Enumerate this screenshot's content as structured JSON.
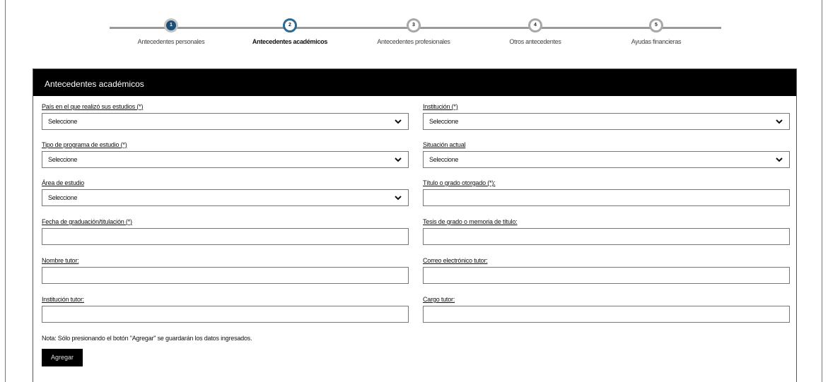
{
  "stepper": {
    "steps": [
      {
        "number": "1",
        "label": "Antecedentes personales",
        "state": "done"
      },
      {
        "number": "2",
        "label": "Antecedentes académicos",
        "state": "current"
      },
      {
        "number": "3",
        "label": "Antecedentes profesionales",
        "state": "pending"
      },
      {
        "number": "4",
        "label": "Otros antecedentes",
        "state": "pending"
      },
      {
        "number": "5",
        "label": "Ayudas financieras",
        "state": "pending"
      }
    ]
  },
  "panel": {
    "title": "Antecedentes académicos",
    "fields": {
      "pais": {
        "label": "País en el que realizó sus estudios (*)",
        "value": "Seleccione"
      },
      "institucion": {
        "label": "Institución (*)",
        "value": "Seleccione"
      },
      "tipo_programa": {
        "label": "Tipo de programa de estudio (*)",
        "value": "Seleccione"
      },
      "situacion": {
        "label": "Situación actual",
        "value": "Seleccione"
      },
      "area": {
        "label": "Área de estudio",
        "value": "Seleccione"
      },
      "titulo": {
        "label": "Título o grado otorgado (*):",
        "value": ""
      },
      "fecha": {
        "label": "Fecha de graduación/titulación (*)",
        "value": ""
      },
      "tesis": {
        "label": "Tesis de grado o memoria de título:",
        "value": ""
      },
      "nombre_tutor": {
        "label": "Nombre tutor:",
        "value": ""
      },
      "correo_tutor": {
        "label": "Correo electrónico tutor:",
        "value": ""
      },
      "institucion_tutor": {
        "label": "Institución tutor:",
        "value": ""
      },
      "cargo_tutor": {
        "label": "Cargo tutor:",
        "value": ""
      }
    },
    "note": "Nota: Sólo presionando el botón \"Agregar\" se guardarán los datos ingresados.",
    "add_button": "Agregar"
  },
  "colors": {
    "header_bg": "#000000",
    "step_done": "#1b4f7a",
    "step_current_border": "#2d6a95"
  }
}
